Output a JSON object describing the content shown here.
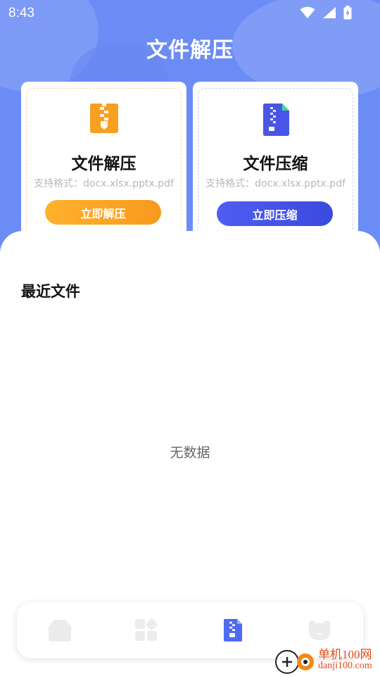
{
  "status_bar": {
    "time": "8:43"
  },
  "header": {
    "title": "文件解压"
  },
  "cards": [
    {
      "title": "文件解压",
      "formats": "支持格式：docx.xlsx.pptx.pdf",
      "button_label": "立即解压",
      "icon": "zip-file-icon",
      "accent": "#f89a1c"
    },
    {
      "title": "文件压缩",
      "formats": "支持格式：docx.xlsx.pptx.pdf",
      "button_label": "立即压缩",
      "icon": "compressed-file-icon",
      "accent": "#4452e8"
    }
  ],
  "recent": {
    "title": "最近文件",
    "empty_text": "无数据"
  },
  "tab_bar": {
    "tabs": [
      {
        "icon": "home-icon",
        "active": false
      },
      {
        "icon": "apps-icon",
        "active": false
      },
      {
        "icon": "archive-icon",
        "active": true
      },
      {
        "icon": "profile-icon",
        "active": false
      }
    ],
    "active_color": "#4f6bf0",
    "inactive_color": "#ececec"
  },
  "watermark": {
    "line1": "单机100网",
    "line2": "danji100.com"
  }
}
